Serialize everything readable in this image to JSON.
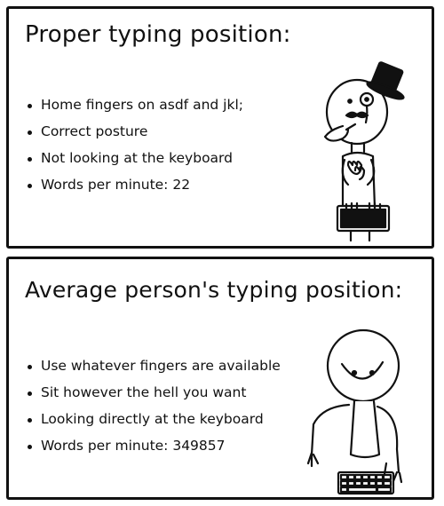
{
  "top_panel": {
    "title": "Proper typing position:",
    "items": [
      "Home fingers on asdf and jkl;",
      "Correct posture",
      "Not looking at the keyboard",
      "Words per minute: 22"
    ]
  },
  "bottom_panel": {
    "title": "Average person's typing position:",
    "items": [
      "Use whatever fingers are available",
      "Sit however the hell you want",
      "Looking directly at the keyboard",
      "Words per minute: 349857"
    ]
  },
  "icons": {
    "top_figure": "gentleman-stick-figure-with-top-hat-and-monocle",
    "bottom_figure": "smiling-stick-figure-typing"
  }
}
